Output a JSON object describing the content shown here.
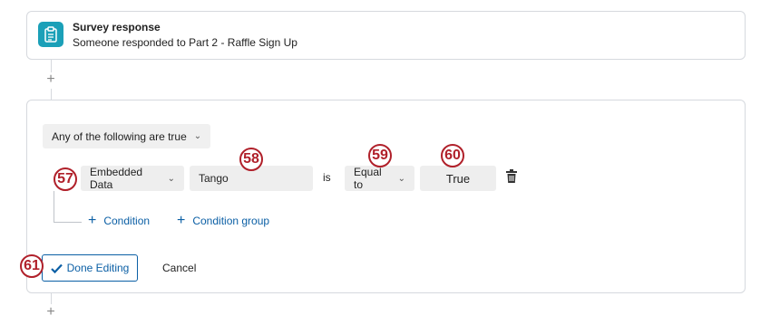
{
  "trigger": {
    "title": "Survey response",
    "subtitle": "Someone responded to Part 2 - Raffle Sign Up",
    "icon": "clipboard-icon"
  },
  "condition_block": {
    "match_mode": "Any of the following are true",
    "row": {
      "field_type": "Embedded Data",
      "field_value": "Tango",
      "operator_word": "is",
      "comparison": "Equal to",
      "value": "True"
    },
    "add_condition": "Condition",
    "add_condition_group": "Condition group",
    "done_label": "Done Editing",
    "cancel_label": "Cancel"
  },
  "callouts": {
    "c57": "57",
    "c58": "58",
    "c59": "59",
    "c60": "60",
    "c61": "61"
  },
  "colors": {
    "accent": "#0b5fa5",
    "icon_bg": "#1ba0b8",
    "callout": "#b0202a"
  }
}
